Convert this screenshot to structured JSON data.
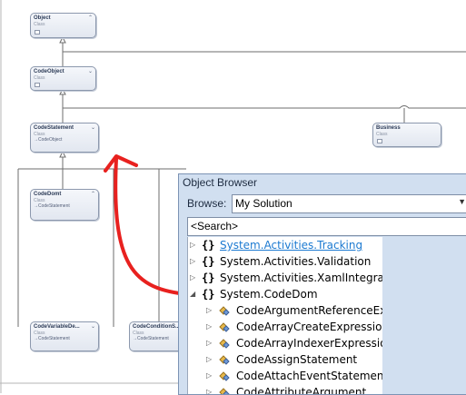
{
  "diagram": {
    "classes": [
      {
        "id": "object",
        "name": "Object",
        "kind": "Class",
        "base": ""
      },
      {
        "id": "codeobject",
        "name": "CodeObject",
        "kind": "Class",
        "base": ""
      },
      {
        "id": "codestatement",
        "name": "CodeStatement",
        "kind": "Class",
        "base": "CodeObject"
      },
      {
        "id": "business",
        "name": "Business",
        "kind": "Class",
        "base": ""
      },
      {
        "id": "codedomt",
        "name": "CodeDomt",
        "kind": "Class",
        "base": "CodeStatement"
      },
      {
        "id": "codevariable",
        "name": "CodeVariableDe...",
        "kind": "Class",
        "base": "CodeStatement"
      },
      {
        "id": "codecondition",
        "name": "CodeConditionS...",
        "kind": "Class",
        "base": "CodeStatement"
      }
    ],
    "annotation_color": "#e8211f"
  },
  "object_browser": {
    "title": "Object Browser",
    "browse_label": "Browse:",
    "browse_value": "My Solution",
    "search_placeholder": "<Search>",
    "tree": [
      {
        "label": "System.Activities.Tracking",
        "type": "namespace",
        "expander": "collapsed",
        "link": true
      },
      {
        "label": "System.Activities.Validation",
        "type": "namespace",
        "expander": "collapsed"
      },
      {
        "label": "System.Activities.XamlIntegratic",
        "type": "namespace",
        "expander": "collapsed"
      },
      {
        "label": "System.CodeDom",
        "type": "namespace",
        "expander": "expanded"
      },
      {
        "label": "CodeArgumentReferenceExp",
        "type": "class",
        "expander": "collapsed"
      },
      {
        "label": "CodeArrayCreateExpression",
        "type": "class",
        "expander": "collapsed"
      },
      {
        "label": "CodeArrayIndexerExpression",
        "type": "class",
        "expander": "collapsed"
      },
      {
        "label": "CodeAssignStatement",
        "type": "class",
        "expander": "collapsed"
      },
      {
        "label": "CodeAttachEventStatement",
        "type": "class",
        "expander": "collapsed"
      },
      {
        "label": "CodeAttributeArgument",
        "type": "class",
        "expander": "collapsed"
      }
    ]
  }
}
